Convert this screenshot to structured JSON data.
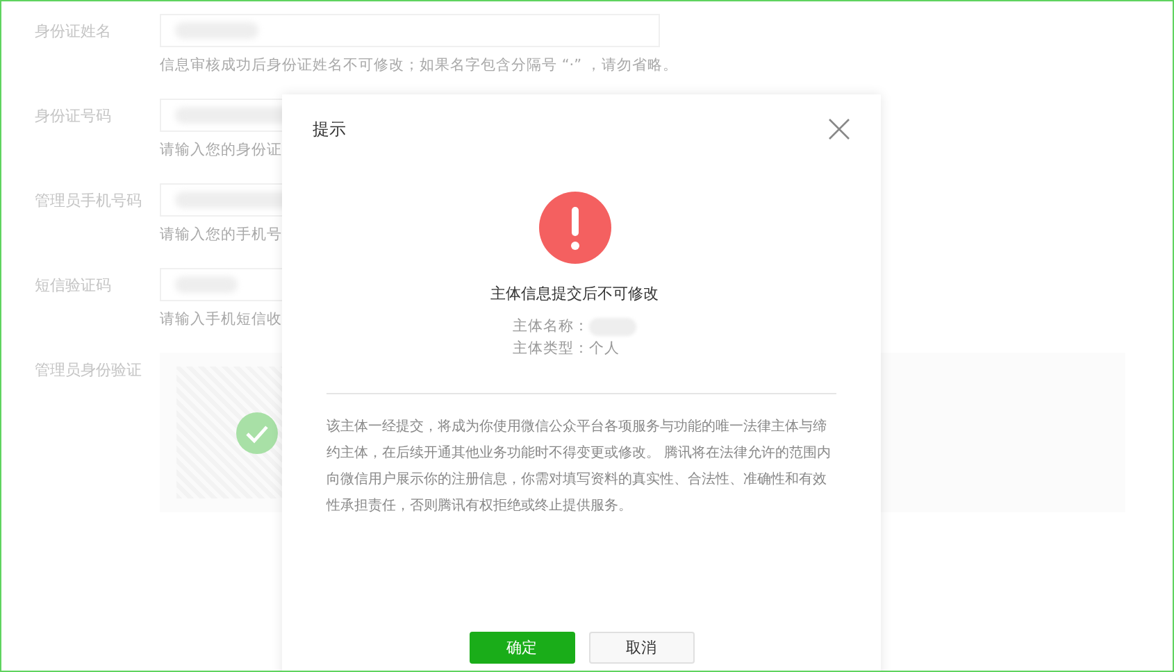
{
  "form": {
    "fields": [
      {
        "label": "身份证姓名",
        "hint": "信息审核成功后身份证姓名不可修改；如果名字包含分隔号 “·” ，请勿省略。"
      },
      {
        "label": "身份证号码",
        "hint": "请输入您的身份证"
      },
      {
        "label": "管理员手机号码",
        "hint": "请输入您的手机号"
      },
      {
        "label": "短信验证码",
        "hint": "请输入手机短信收"
      }
    ],
    "verification": {
      "label": "管理员身份验证",
      "verified": true
    }
  },
  "dialog": {
    "title": "提示",
    "heading": "主体信息提交后不可修改",
    "info": [
      {
        "label": "主体名称：",
        "value_hidden": true
      },
      {
        "label": "主体类型：个人",
        "value_hidden": false
      }
    ],
    "notice": "该主体一经提交，将成为你使用微信公众平台各项服务与功能的唯一法律主体与缔约主体，在后续开通其他业务功能时不得变更或修改。 腾讯将在法律允许的范围内向微信用户展示你的注册信息，你需对填写资料的真实性、合法性、准确性和有效性承担责任，否则腾讯有权拒绝或终止提供服务。",
    "buttons": [
      {
        "label": "确定",
        "kind": "primary"
      },
      {
        "label": "取消",
        "kind": "default"
      }
    ]
  }
}
